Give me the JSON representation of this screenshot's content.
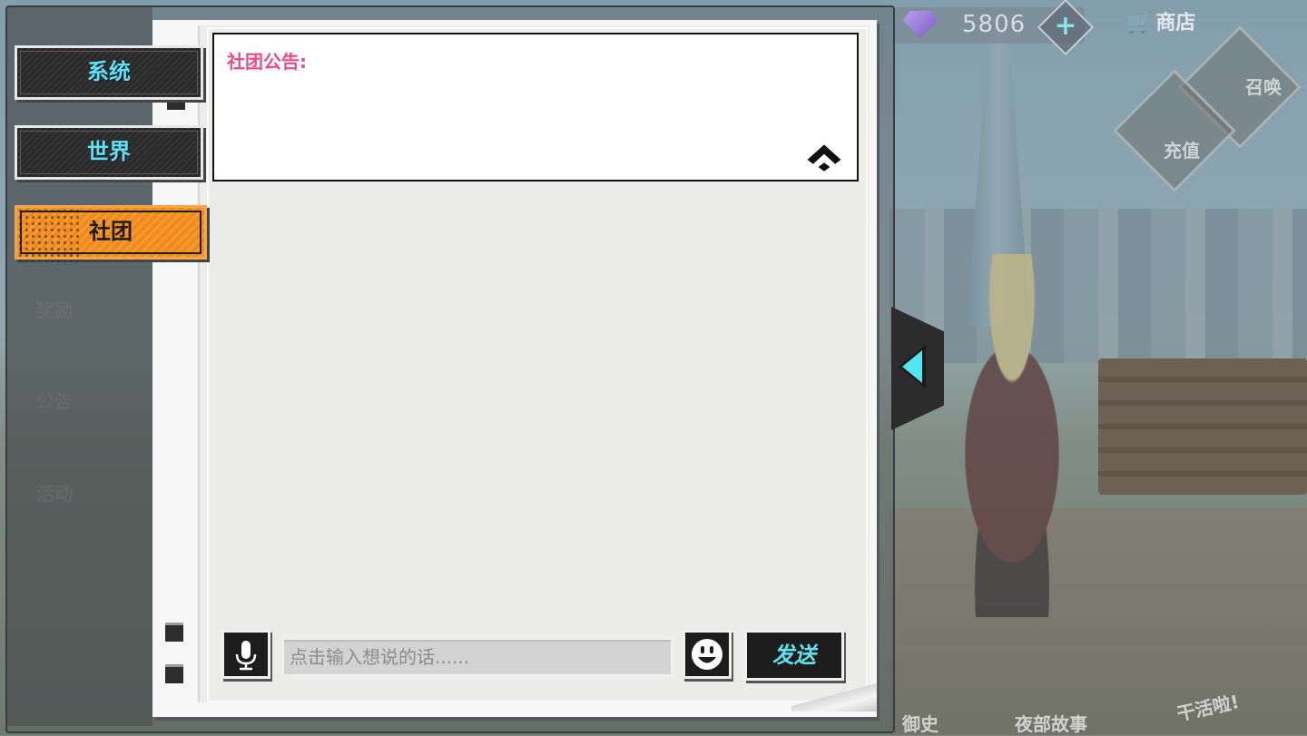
{
  "hud": {
    "gem_count": "5806",
    "shop_label": "商店",
    "summon_label": "召唤",
    "recharge_label": "充值"
  },
  "left_menu_ghost": {
    "reward": "奖励",
    "notice": "公告",
    "event": "活动"
  },
  "bottom_menu": {
    "history": "御史",
    "night_story": "夜部故事",
    "work": "干活啦!"
  },
  "tabs": [
    {
      "label": "系统",
      "active": false
    },
    {
      "label": "世界",
      "active": false
    },
    {
      "label": "社团",
      "active": true
    }
  ],
  "notice": {
    "title": "社团公告:"
  },
  "input": {
    "placeholder": "点击输入想说的话......"
  },
  "send_label": "发送",
  "colors": {
    "accent_cyan": "#5fe3ee",
    "tab_active_orange": "#f08a1c",
    "notice_pink": "#e84a8c"
  }
}
